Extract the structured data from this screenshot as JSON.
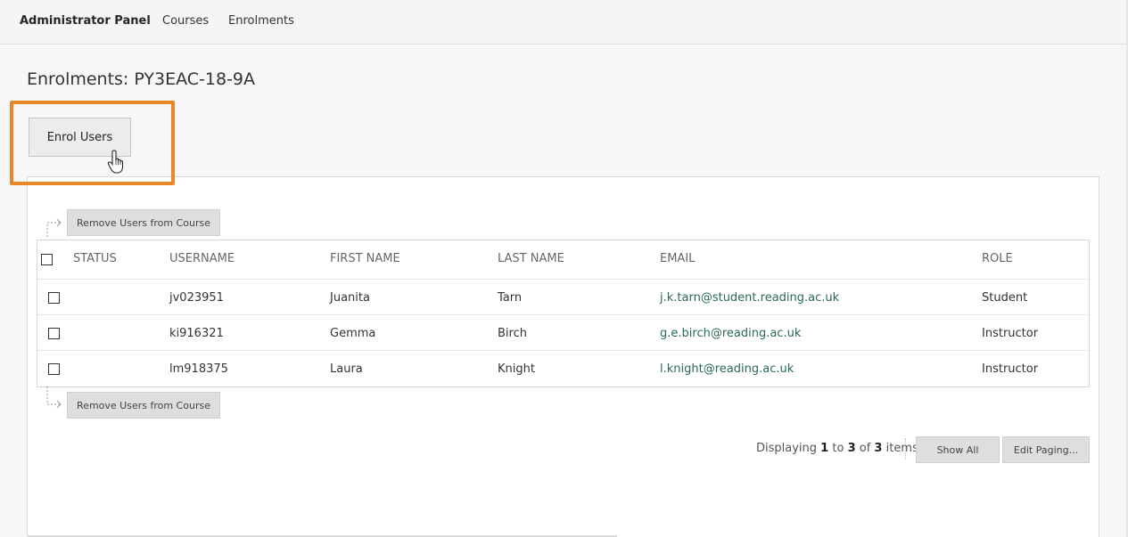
{
  "nav": {
    "brand": "Administrator Panel",
    "links": [
      "Courses",
      "Enrolments"
    ]
  },
  "page": {
    "title": "Enrolments: PY3EAC-18-9A",
    "enrol_button": "Enrol Users"
  },
  "actions": {
    "remove_top": "Remove Users from Course",
    "remove_bottom": "Remove Users from Course"
  },
  "table": {
    "columns": [
      "STATUS",
      "USERNAME",
      "FIRST NAME",
      "LAST NAME",
      "EMAIL",
      "ROLE"
    ],
    "rows": [
      {
        "status": "",
        "username": "jv023951",
        "first": "Juanita",
        "last": "Tarn",
        "email": "j.k.tarn@student.reading.ac.uk",
        "role": "Student"
      },
      {
        "status": "",
        "username": "ki916321",
        "first": "Gemma",
        "last": "Birch",
        "email": "g.e.birch@reading.ac.uk",
        "role": "Instructor"
      },
      {
        "status": "",
        "username": "lm918375",
        "first": "Laura",
        "last": "Knight",
        "email": "l.knight@reading.ac.uk",
        "role": "Instructor"
      }
    ]
  },
  "paging": {
    "prefix": "Displaying",
    "from": "1",
    "to_word": "to",
    "to": "3",
    "of_word": "of",
    "total": "3",
    "suffix": "items",
    "show_all": "Show All",
    "edit_paging": "Edit Paging..."
  },
  "colors": {
    "highlight": "#e9862a",
    "email_link": "#2a6a4f"
  },
  "icons": [
    "hand-pointer-icon",
    "dotted-arrow-icon"
  ]
}
